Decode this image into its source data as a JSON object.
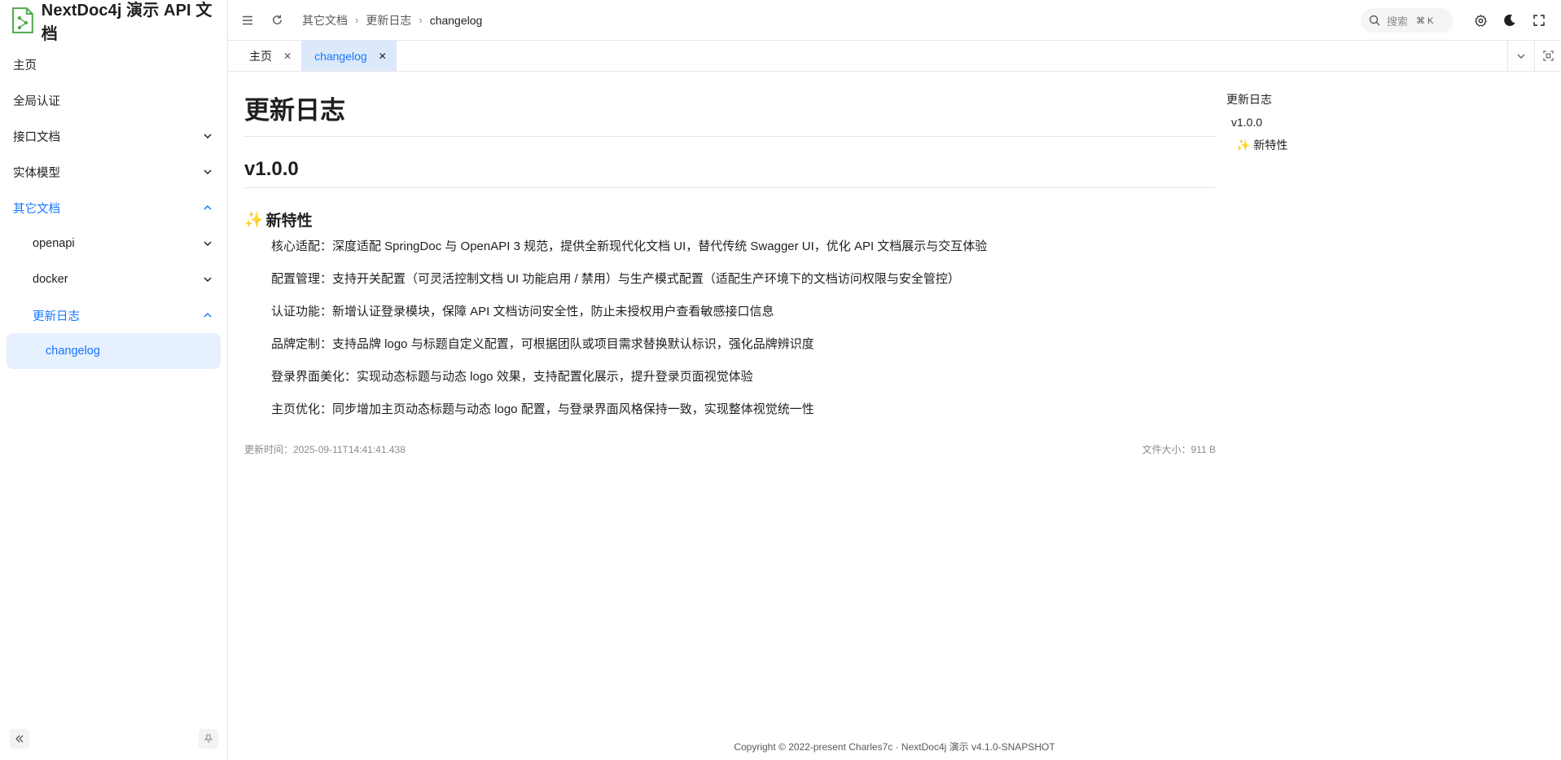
{
  "app": {
    "title": "NextDoc4j 演示 API 文档"
  },
  "sidebar": {
    "items": [
      {
        "label": "主页"
      },
      {
        "label": "全局认证"
      },
      {
        "label": "接口文档"
      },
      {
        "label": "实体模型"
      },
      {
        "label": "其它文档"
      },
      {
        "label": "openapi"
      },
      {
        "label": "docker"
      },
      {
        "label": "更新日志"
      },
      {
        "label": "changelog"
      }
    ]
  },
  "header": {
    "breadcrumb": [
      "其它文档",
      "更新日志",
      "changelog"
    ],
    "search_placeholder": "搜索",
    "search_shortcut": "⌘ K"
  },
  "tabs": [
    {
      "label": "主页"
    },
    {
      "label": "changelog"
    }
  ],
  "content": {
    "title": "更新日志",
    "version": "v1.0.0",
    "section_icon": "✨",
    "section": "新特性",
    "features": [
      "核心适配：深度适配 SpringDoc 与 OpenAPI 3 规范，提供全新现代化文档 UI，替代传统 Swagger UI，优化 API 文档展示与交互体验",
      "配置管理：支持开关配置（可灵活控制文档 UI 功能启用 / 禁用）与生产模式配置（适配生产环境下的文档访问权限与安全管控）",
      "认证功能：新增认证登录模块，保障 API 文档访问安全性，防止未授权用户查看敏感接口信息",
      "品牌定制：支持品牌 logo 与标题自定义配置，可根据团队或项目需求替换默认标识，强化品牌辨识度",
      "登录界面美化：实现动态标题与动态 logo 效果，支持配置化展示，提升登录页面视觉体验",
      "主页优化：同步增加主页动态标题与动态 logo 配置，与登录界面风格保持一致，实现整体视觉统一性"
    ],
    "updated_time": "更新时间：2025-09-11T14:41:41.438",
    "file_size": "文件大小：911 B"
  },
  "toc": {
    "title": "更新日志",
    "items": [
      "v1.0.0",
      "✨ 新特性"
    ]
  },
  "footer": {
    "copyright": "Copyright © 2022-present Charles7c · NextDoc4j 演示 v4.1.0-SNAPSHOT"
  },
  "colors": {
    "accent": "#1677ff",
    "selected_bg": "#e6f0ff",
    "active_tab_bg": "#dce9fb",
    "logo_green": "#52a94f"
  }
}
